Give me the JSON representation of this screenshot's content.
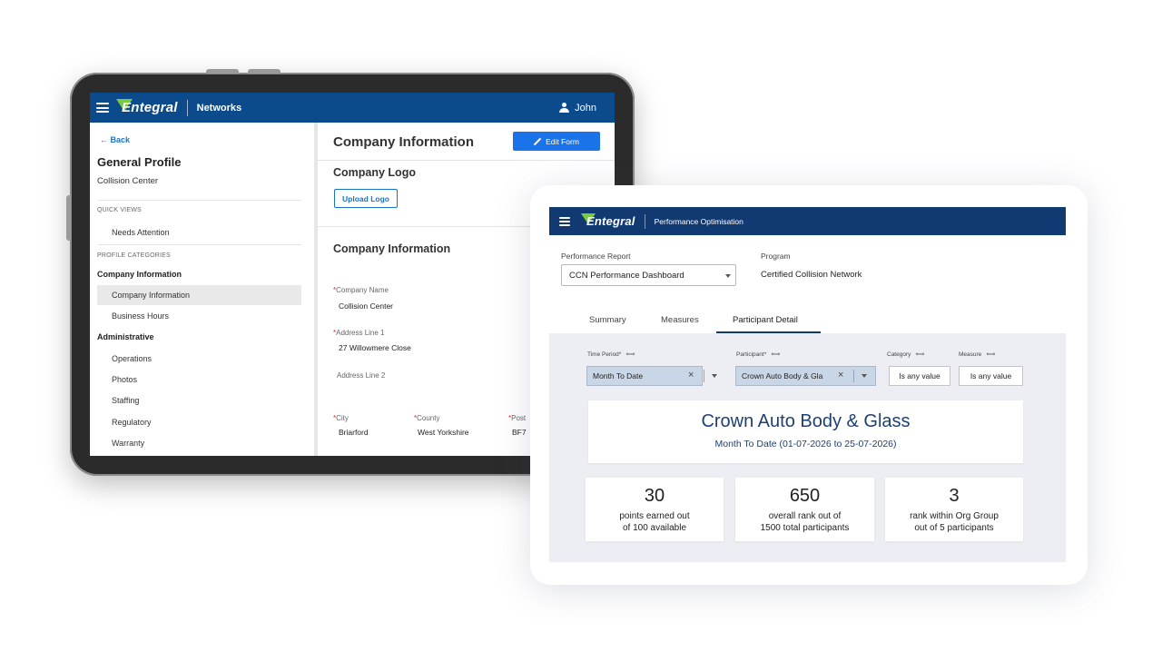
{
  "tablet": {
    "header": {
      "brand": "Entegral",
      "app": "Networks",
      "user": "John"
    },
    "sidebar": {
      "back": "Back",
      "title": "General Profile",
      "subtitle": "Collision Center",
      "quick_views_label": "QUICK VIEWS",
      "quick_views": [
        "Needs Attention"
      ],
      "profile_categories_label": "PROFILE CATEGORIES",
      "groups": [
        {
          "label": "Company Information",
          "items": [
            "Company Information",
            "Business Hours"
          ]
        },
        {
          "label": "Administrative",
          "items": [
            "Operations",
            "Photos",
            "Staffing",
            "Regulatory",
            "Warranty"
          ]
        }
      ]
    },
    "main": {
      "title": "Company Information",
      "edit_button": "Edit Form",
      "logo_heading": "Company Logo",
      "upload_button": "Upload Logo",
      "section_heading": "Company Information",
      "fields": {
        "company_name_label": "Company Name",
        "company_name": "Collision Center",
        "address1_label": "Address Line 1",
        "address1": "27 Willowmere Close",
        "address2_label": "Address Line 2",
        "city_label": "City",
        "city": "Briarford",
        "county_label": "County",
        "county": "West Yorkshire",
        "postcode_label": "Post",
        "postcode": "BF7"
      }
    }
  },
  "card": {
    "header": {
      "brand": "Entegral",
      "app": "Performance Optimisation"
    },
    "report_label": "Performance Report",
    "report_value": "CCN Performance Dashboard",
    "program_label": "Program",
    "program_value": "Certified Collision Network",
    "tabs": [
      "Summary",
      "Measures",
      "Participant Detail"
    ],
    "active_tab": "Participant Detail",
    "filters": {
      "time_period_label": "Time Period*",
      "time_period": "Month To Date",
      "participant_label": "Participant*",
      "participant": "Crown Auto Body & Gla",
      "category_label": "Category",
      "category": "Is any value",
      "measure_label": "Measure",
      "measure": "Is any value"
    },
    "hero": {
      "name": "Crown Auto Body & Glass",
      "period": "Month To Date (01-07-2026 to 25-07-2026)"
    },
    "stats": [
      {
        "value": "30",
        "line1": "points earned out",
        "line2": "of 100 available"
      },
      {
        "value": "650",
        "line1": "overall rank out of",
        "line2": "1500 total participants"
      },
      {
        "value": "3",
        "line1": "rank within Org Group",
        "line2": "out of 5 participants"
      }
    ]
  },
  "colors": {
    "header_blue": "#0b4a8b",
    "header_navy": "#123a72",
    "accent": "#1a73e8",
    "logo_green": "#7ac943",
    "filter_area": "#eceef3"
  }
}
